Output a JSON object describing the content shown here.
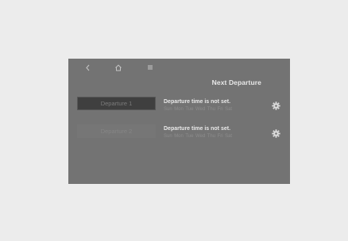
{
  "header": {
    "title": "Next Departure"
  },
  "nav": {
    "icons": [
      "back-icon",
      "home-icon",
      "menu-icon"
    ]
  },
  "departures": [
    {
      "label": "Departure 1",
      "status": "Departure time is not set.",
      "days": [
        "Sun",
        "Mon",
        "Tue",
        "Wed",
        "Thu",
        "Fri",
        "Sat"
      ]
    },
    {
      "label": "Departure 2",
      "status": "Departure time is not set.",
      "days": [
        "Sun",
        "Mon",
        "Tue",
        "Wed",
        "Thu",
        "Fri",
        "Sat"
      ]
    }
  ],
  "colors": {
    "page_bg": "#ececec",
    "screen_bg": "#737373",
    "selected_button_bg": "#3f3f3f"
  }
}
